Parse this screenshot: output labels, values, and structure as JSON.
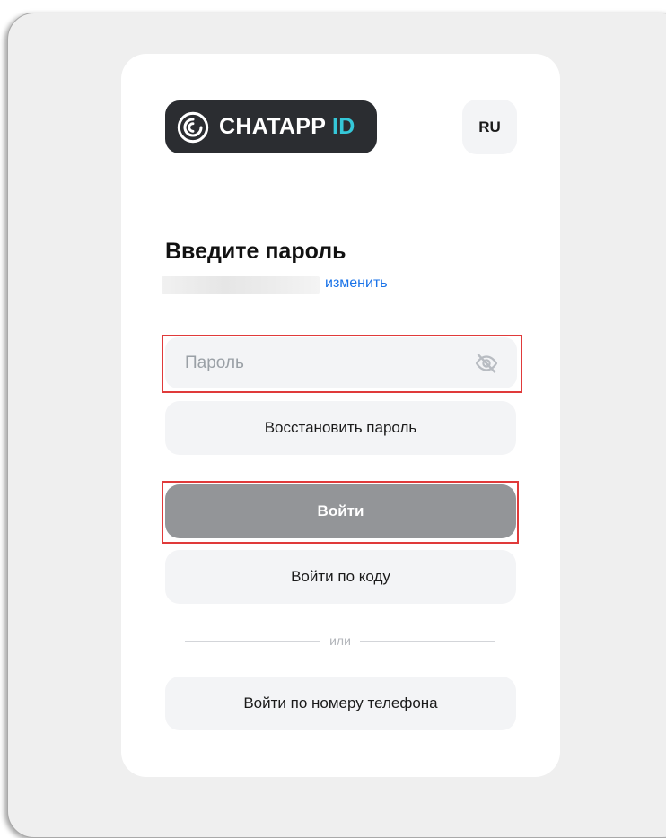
{
  "logo": {
    "text_main": "CHATAPP ",
    "text_accent": "ID"
  },
  "language": {
    "label": "RU"
  },
  "form": {
    "title": "Введите пароль",
    "change_link": "изменить",
    "password_placeholder": "Пароль",
    "restore_button": "Восстановить пароль",
    "login_button": "Войти",
    "login_by_code_button": "Войти по коду",
    "divider_text": "или",
    "login_by_phone_button": "Войти по номеру телефона"
  },
  "colors": {
    "accent": "#35c7d8",
    "link": "#1a73e8",
    "primary_button": "#939598",
    "highlight": "#e03a3a"
  },
  "icons": {
    "logo": "chatapp-logo-icon",
    "password_visibility": "eye-off-icon"
  }
}
